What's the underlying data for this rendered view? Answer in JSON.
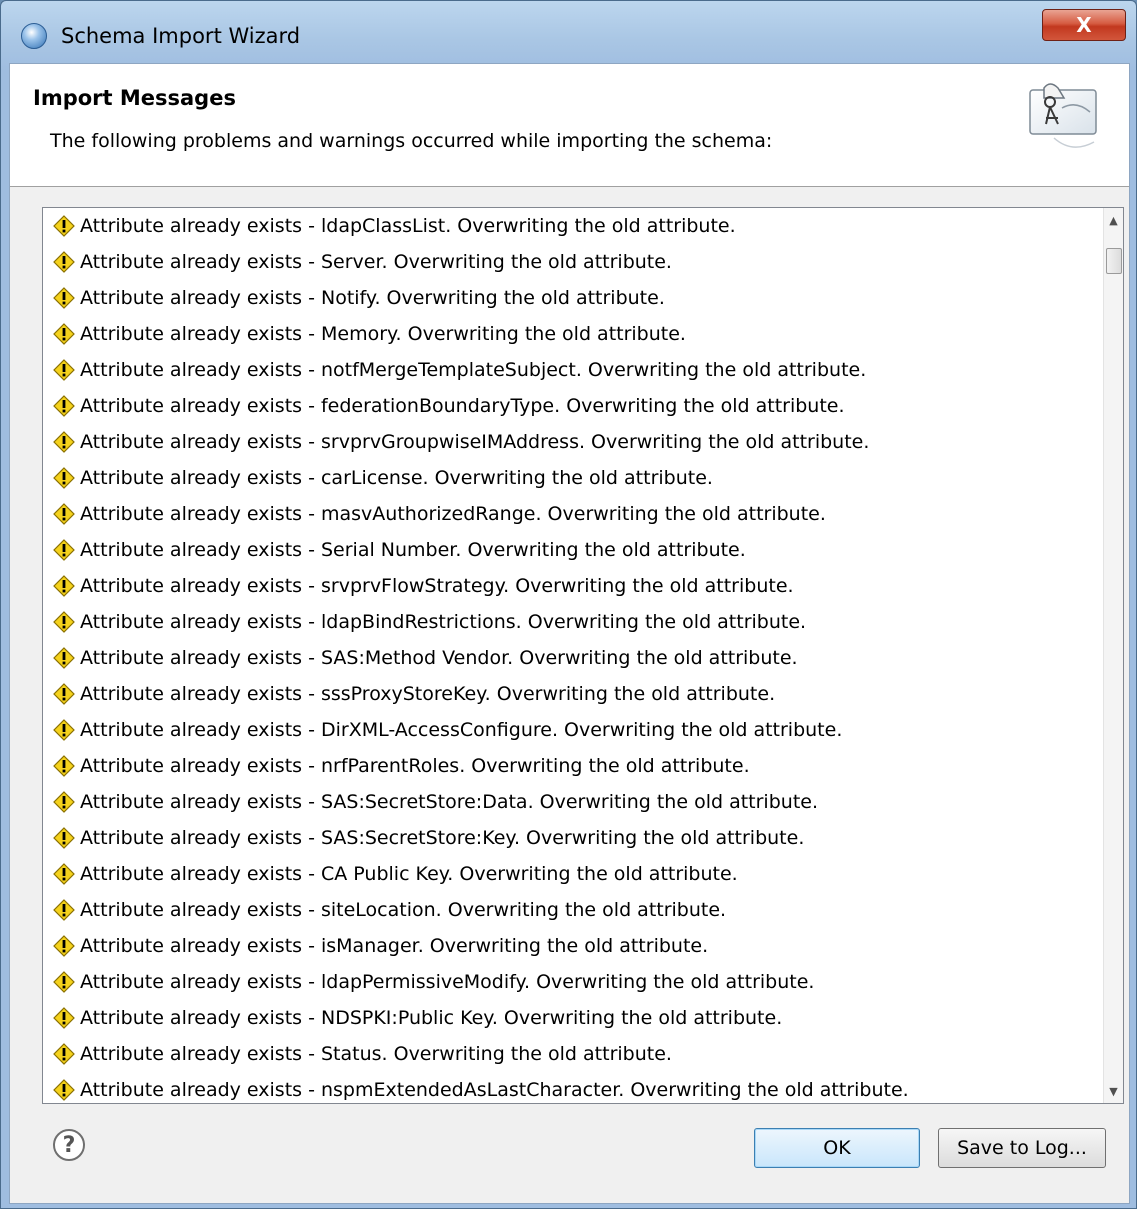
{
  "window": {
    "title": "Schema Import Wizard",
    "close_label": "X"
  },
  "header": {
    "title": "Import Messages",
    "description": "The following problems and warnings occurred while importing the schema:"
  },
  "messages": [
    "Attribute already exists - ldapClassList.  Overwriting the old attribute.",
    "Attribute already exists - Server.  Overwriting the old attribute.",
    "Attribute already exists - Notify.  Overwriting the old attribute.",
    "Attribute already exists - Memory.  Overwriting the old attribute.",
    "Attribute already exists - notfMergeTemplateSubject.  Overwriting the old attribute.",
    "Attribute already exists - federationBoundaryType.  Overwriting the old attribute.",
    "Attribute already exists - srvprvGroupwiseIMAddress.  Overwriting the old attribute.",
    "Attribute already exists - carLicense.  Overwriting the old attribute.",
    "Attribute already exists - masvAuthorizedRange.  Overwriting the old attribute.",
    "Attribute already exists - Serial Number.  Overwriting the old attribute.",
    "Attribute already exists - srvprvFlowStrategy.  Overwriting the old attribute.",
    "Attribute already exists - ldapBindRestrictions.  Overwriting the old attribute.",
    "Attribute already exists - SAS:Method Vendor.  Overwriting the old attribute.",
    "Attribute already exists - sssProxyStoreKey.  Overwriting the old attribute.",
    "Attribute already exists - DirXML-AccessConfigure.  Overwriting the old attribute.",
    "Attribute already exists - nrfParentRoles.  Overwriting the old attribute.",
    "Attribute already exists - SAS:SecretStore:Data.  Overwriting the old attribute.",
    "Attribute already exists - SAS:SecretStore:Key.  Overwriting the old attribute.",
    "Attribute already exists - CA Public Key.  Overwriting the old attribute.",
    "Attribute already exists - siteLocation.  Overwriting the old attribute.",
    "Attribute already exists - isManager.  Overwriting the old attribute.",
    "Attribute already exists - ldapPermissiveModify.  Overwriting the old attribute.",
    "Attribute already exists - NDSPKI:Public Key.  Overwriting the old attribute.",
    "Attribute already exists - Status.  Overwriting the old attribute.",
    "Attribute already exists - nspmExtendedAsLastCharacter.  Overwriting the old attribute."
  ],
  "icons": {
    "message": "warning-icon",
    "help": "help-icon",
    "app": "wizard-app-icon",
    "banner": "schema-wizard-graphic"
  },
  "buttons": {
    "help_glyph": "?",
    "ok": "OK",
    "save_to_log": "Save to Log..."
  },
  "scrollbar": {
    "up_glyph": "▲",
    "down_glyph": "▼",
    "position": 0.0
  },
  "colors": {
    "warning_fill": "#f5d21c",
    "warning_stroke": "#8a7000",
    "close_button": "#c8412a",
    "ok_border": "#3c7fb1"
  }
}
